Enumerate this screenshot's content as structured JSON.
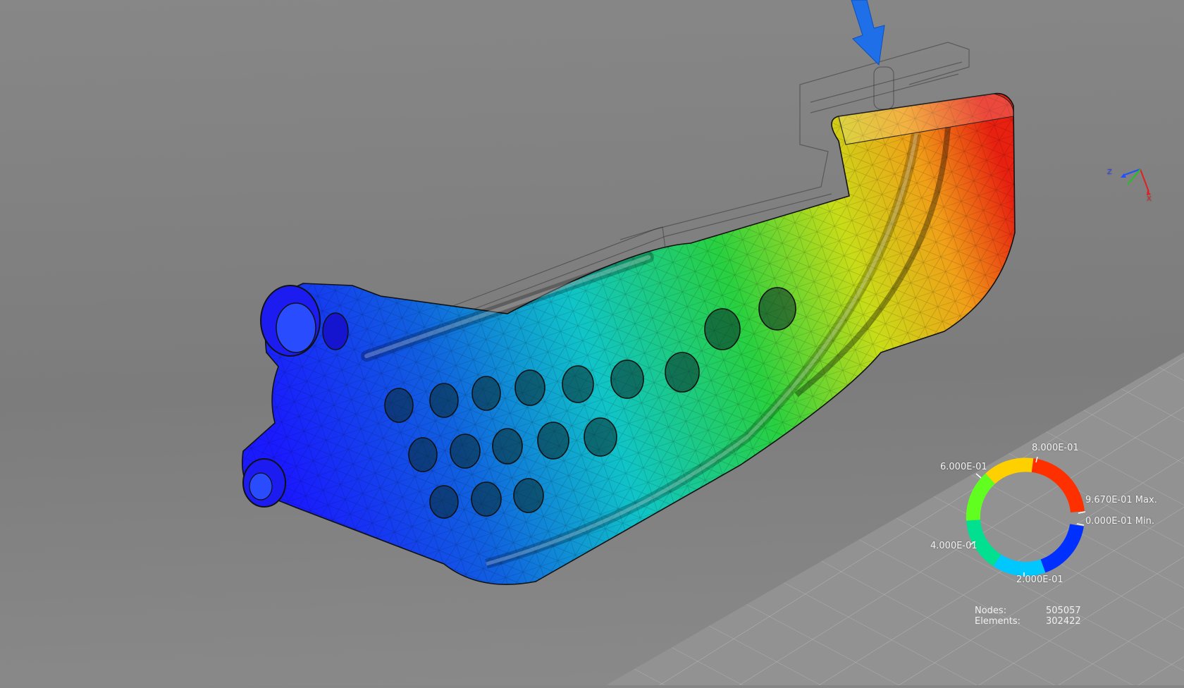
{
  "legend": {
    "max_label": "9.670E-01 Max.",
    "min_label": "0.000E-01 Min.",
    "ticks": [
      "8.000E-01",
      "6.000E-01",
      "4.000E-01",
      "2.000E-01"
    ],
    "colors": [
      "#0000ff",
      "#00e6ff",
      "#00ff40",
      "#ffff00",
      "#ff0000"
    ]
  },
  "stats": {
    "nodes_label": "Nodes:",
    "nodes_value": "505057",
    "elements_label": "Elements:",
    "elements_value": "302422"
  },
  "triad": {
    "z_label": "Z",
    "x_label": "X"
  },
  "colors": {
    "background": "#808080",
    "load_arrow": "#1f6fe8"
  },
  "icons": {
    "load_arrow": "arrow-down-icon",
    "triad": "axis-triad-icon"
  }
}
